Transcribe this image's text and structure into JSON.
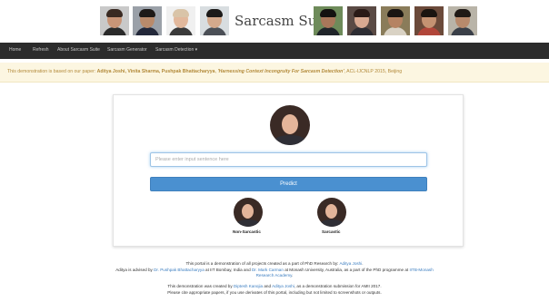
{
  "header": {
    "title": "Sarcasm Suite",
    "avatars": [
      {
        "name": "person-photo-icon",
        "bg": "#c9c9c9",
        "skin": "#c99577",
        "hair": "#3a2a22",
        "shirt": "#2a2a2a"
      },
      {
        "name": "person-photo-icon",
        "bg": "#9aa0a8",
        "skin": "#b98a6b",
        "hair": "#1e1a18",
        "shirt": "#23283a"
      },
      {
        "name": "person-photo-icon",
        "bg": "#f0f0f0",
        "skin": "#e2b89c",
        "hair": "#d9c4a8",
        "shirt": "#3a3a3a"
      },
      {
        "name": "person-photo-icon",
        "bg": "#d8dde0",
        "skin": "#d4a98c",
        "hair": "#1c1a19",
        "shirt": "#4b4f56"
      },
      {
        "name": "person-photo-icon",
        "bg": "#6e8b5a",
        "skin": "#a8775a",
        "hair": "#141210",
        "shirt": "#20252a"
      },
      {
        "name": "person-photo-icon",
        "bg": "#5a4a44",
        "skin": "#d8a991",
        "hair": "#2a1a16",
        "shirt": "#2d2d33"
      },
      {
        "name": "person-photo-icon",
        "bg": "#8a7c5a",
        "skin": "#b58362",
        "hair": "#1a1512",
        "shirt": "#d9d2c4"
      },
      {
        "name": "person-photo-icon",
        "bg": "#6b4a3a",
        "skin": "#c49272",
        "hair": "#1a1410",
        "shirt": "#b1463a"
      },
      {
        "name": "person-photo-icon",
        "bg": "#b9b4a8",
        "skin": "#b88a6c",
        "hair": "#201a16",
        "shirt": "#3a3f48"
      }
    ]
  },
  "nav": {
    "home": "Home",
    "refresh": "Refresh",
    "about": "About Sarcasm Suite",
    "generator": "Sarcasm Generator",
    "detection": "Sarcasm Detection",
    "caret": "▾"
  },
  "notice": {
    "prefix": "This demonstration is based on our paper: ",
    "authors": "Aditya Joshi, Vinita Sharma, Pushpak Bhattacharyya",
    "sep": ", ",
    "paper_title": "'Harnessing Context Incongruity For Sarcasm Detection'",
    "venue": ", ACL-IJCNLP 2015, Beijing"
  },
  "form": {
    "input_value": "",
    "input_placeholder": "Please enter input sentence here",
    "predict_label": "Predict",
    "non_sarcastic_label": "Non-Sarcastic",
    "sarcastic_label": "Sarcastic"
  },
  "footer": {
    "line1_prefix": "This portal is a demonstration of all projects created as a part of PhD Research by: ",
    "line1_link": "Aditya Joshi",
    "line1_suffix": ".",
    "line2_prefix": "Aditya is advised by ",
    "line2_link1": "Dr. Pushpak Bhattacharyya",
    "line2_mid1": " at IIT Bombay, India and ",
    "line2_link2": "Dr. Mark Carman",
    "line2_mid2": " at Monash University, Australia, as a part of the PhD programme at ",
    "line2_link3": "IITB-Monash",
    "line3_link": "Research Academy",
    "line3_suffix": ".",
    "line4_prefix": "This demonstration was created by ",
    "line4_link1": "Diptesh Kanojia",
    "line4_mid": " and ",
    "line4_link2": "Aditya Joshi",
    "line4_suffix": ", as a demonstration submission for AMII 2017.",
    "line5": "Please cite appropriate papers, if you use derivates of this portal, including but not limited to screenshots or outputs."
  },
  "colors": {
    "navbar": "#2c2c2c",
    "notice_bg": "#fcf6e1",
    "notice_text": "#b38a3a",
    "button": "#4a90d0",
    "link": "#3b7dc0"
  }
}
